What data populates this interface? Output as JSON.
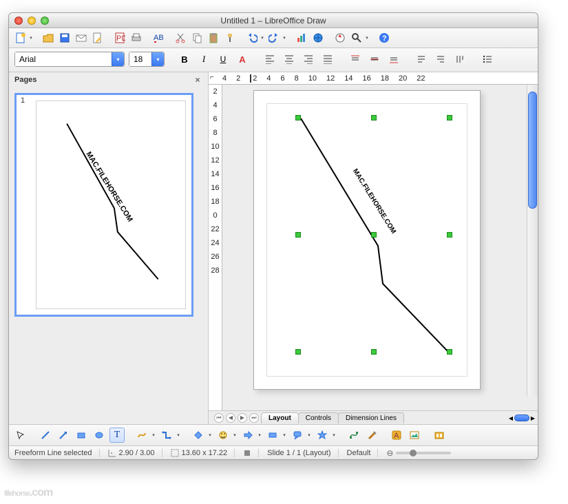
{
  "window": {
    "title": "Untitled 1 – LibreOffice Draw"
  },
  "pages_panel": {
    "title": "Pages",
    "thumb_number": "1"
  },
  "format": {
    "font_name": "Arial",
    "font_size": "18"
  },
  "ruler_h": [
    "4",
    "2",
    "2",
    "4",
    "6",
    "8",
    "10",
    "12",
    "14",
    "16",
    "18",
    "20",
    "22"
  ],
  "ruler_v": [
    "2",
    "4",
    "6",
    "8",
    "10",
    "12",
    "14",
    "16",
    "18",
    "0",
    "22",
    "24",
    "26",
    "28"
  ],
  "canvas_tabs": {
    "layout": "Layout",
    "controls": "Controls",
    "dimension": "Dimension Lines"
  },
  "canvas": {
    "watermark_text": "MAC.FILEHORSE.COM"
  },
  "status": {
    "selection": "Freeform Line selected",
    "pos": "2.90 / 3.00",
    "size": "13.60 x 17.22",
    "slide": "Slide 1 / 1 (Layout)",
    "style": "Default"
  },
  "branding": {
    "logo": "filehorse",
    "tld": ".com"
  },
  "icons": {
    "sun": "sun",
    "open": "open",
    "save": "save",
    "mail": "mail",
    "edit": "edit",
    "pdf": "pdf",
    "print": "print",
    "spell": "spell",
    "cut": "cut",
    "copy": "copy",
    "paste": "paste",
    "brush": "brush",
    "undo": "undo",
    "redo": "redo",
    "chart": "chart",
    "hyperlink": "hyperlink",
    "navigator": "navigator",
    "zoom": "zoom",
    "help": "help",
    "bold": "B",
    "italic": "I",
    "underline": "U",
    "fontfx": "A",
    "left": "⇤",
    "center": "≡",
    "right": "⇥",
    "justify": "≣",
    "top": "⤒",
    "vcenter": "≡",
    "bottom": "⤓",
    "ltr": "¶",
    "rtl": "¶",
    "bullets": "•",
    "select": "↖",
    "line": "／",
    "arrow": "→",
    "rect": "▭",
    "ellipse": "◯",
    "text": "T",
    "curve": "∿",
    "connector": "⎍",
    "shapes": "◆",
    "smiley": "☺",
    "arrows": "⇔",
    "flow": "▭",
    "callout": "💬",
    "star": "☆",
    "points": "✧",
    "glue": "✎",
    "fontwork": "🅰",
    "insimg": "🖼",
    "gallery": "🗂"
  }
}
